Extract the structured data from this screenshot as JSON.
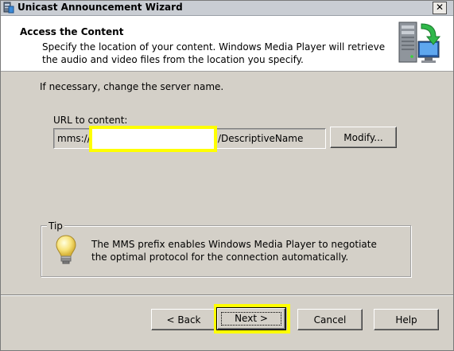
{
  "window": {
    "title": "Unicast Announcement Wizard",
    "close_symbol": "✕",
    "icon": "wizard-app-icon"
  },
  "header": {
    "title": "Access the Content",
    "description": "Specify the location of your content. Windows Media Player will retrieve the audio and video files from the location you specify.",
    "icon": "server-download-icon"
  },
  "main": {
    "server_hint": "If necessary, change the server name.",
    "url_label": "URL to content:",
    "url_prefix": "mms://",
    "server_name_value": "",
    "url_suffix": "/DescriptiveName",
    "modify_label": "Modify..."
  },
  "tip": {
    "legend": "Tip",
    "icon": "lightbulb-icon",
    "text": "The MMS prefix enables Windows Media Player to negotiate the optimal protocol for the connection automatically."
  },
  "buttons": {
    "back": "< Back",
    "next": "Next >",
    "cancel": "Cancel",
    "help": "Help"
  },
  "colors": {
    "highlight": "#ffff00",
    "dialog_bg": "#d4d0c8",
    "header_bg": "#ffffff"
  }
}
